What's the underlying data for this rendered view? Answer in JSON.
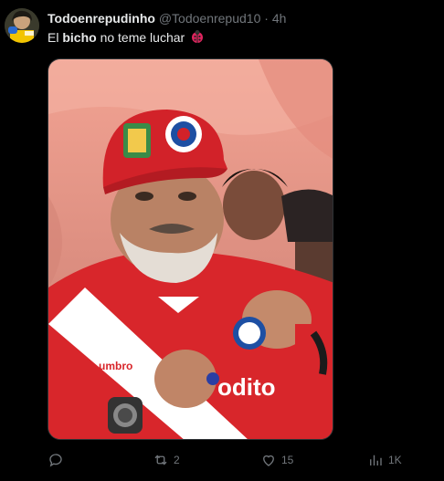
{
  "tweet": {
    "display_name": "Todoenrepudinho",
    "handle": "@Todoenrepud10",
    "separator": "·",
    "time": "4h",
    "text_before": "El ",
    "text_bold": "bicho",
    "text_after": " no teme luchar",
    "emoji_icon": "ladybug-icon"
  },
  "media": {
    "cap_badge_left": "crest-badge",
    "shirt_brand": "umbro",
    "shirt_sponsor": "odito",
    "colors": {
      "shirt": "#d8262b",
      "stripe": "#ffffff",
      "tent": "#e98f82"
    }
  },
  "actions": {
    "reply_count": "",
    "retweet_count": "2",
    "like_count": "15",
    "views_count": "1K"
  },
  "colors": {
    "background": "#000000",
    "text": "#e7e9ea",
    "muted": "#71767b"
  }
}
